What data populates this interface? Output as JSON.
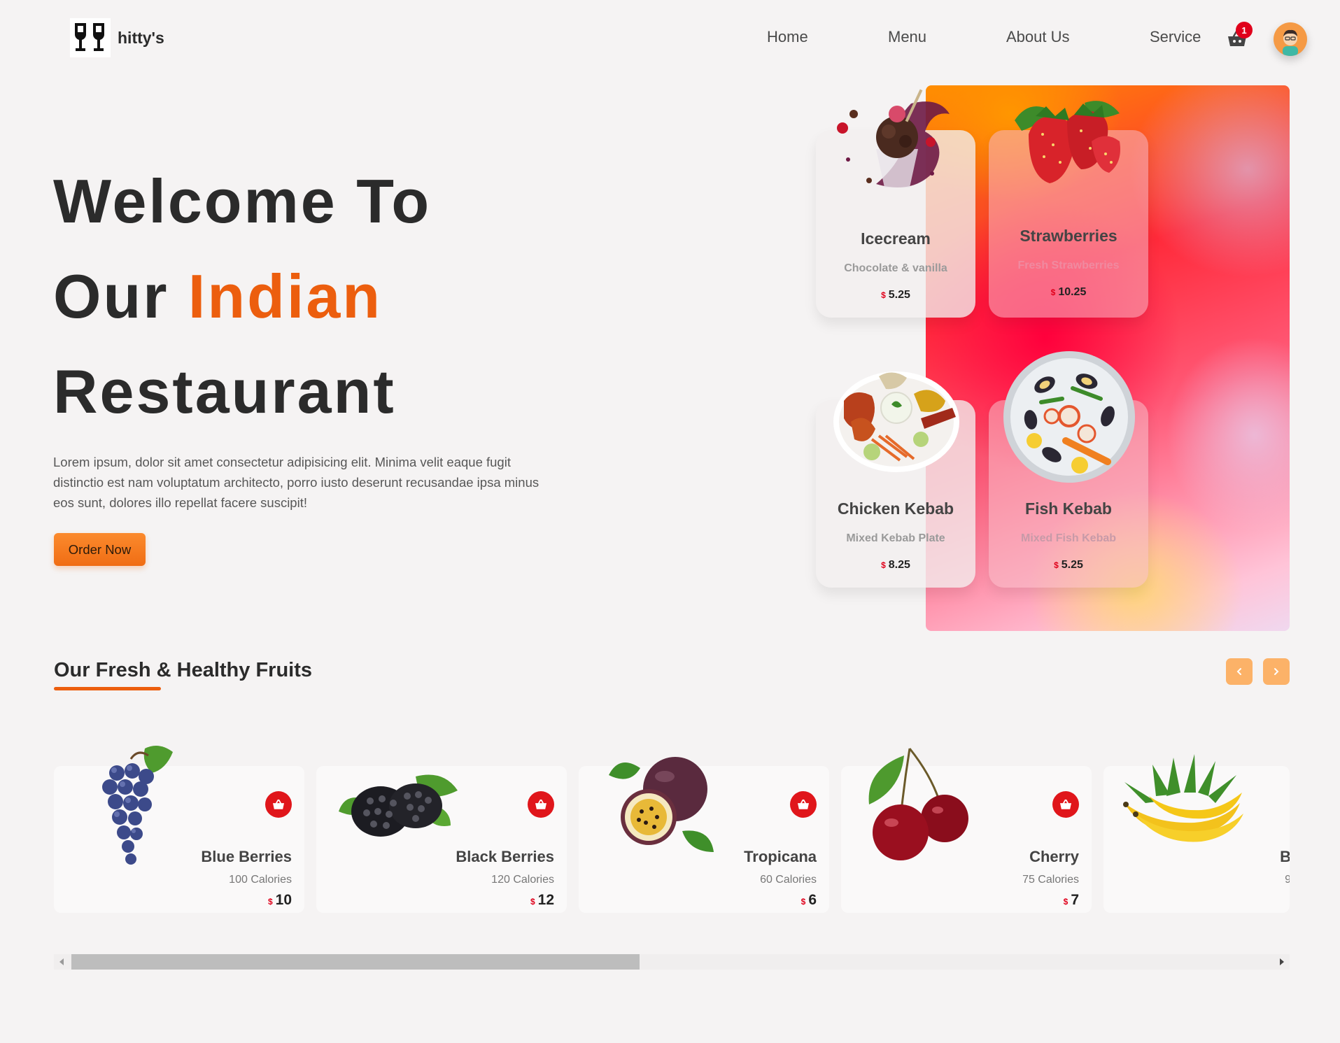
{
  "brand": {
    "name": "hitty's",
    "logo_icon": "wine-glasses-icon"
  },
  "nav": {
    "items": [
      "Home",
      "Menu",
      "About Us",
      "Service"
    ],
    "cart_icon": "basket-icon",
    "cart_count": "1",
    "avatar_icon": "user-avatar-icon"
  },
  "hero": {
    "line1": "Welcome To",
    "line2_plain": "Our",
    "line2_accent": "Indian",
    "line3": "Restaurant",
    "description": "Lorem ipsum, dolor sit amet consectetur adipisicing elit. Minima velit eaque fugit distinctio est nam voluptatum architecto, porro iusto deserunt recusandae ipsa minus eos sunt, dolores illo repellat facere suscipit!",
    "cta": "Order Now",
    "accent_color": "#ec5e0e"
  },
  "featured": [
    {
      "name": "Icecream",
      "sub": "Chocolate & vanilla",
      "currency": "$",
      "price": "5.25",
      "image": "icecream-sundae"
    },
    {
      "name": "Strawberries",
      "sub": "Fresh Strawberries",
      "currency": "$",
      "price": "10.25",
      "image": "strawberries"
    },
    {
      "name": "Chicken Kebab",
      "sub": "Mixed Kebab Plate",
      "currency": "$",
      "price": "8.25",
      "image": "kebab-plate"
    },
    {
      "name": "Fish Kebab",
      "sub": "Mixed Fish Kebab",
      "currency": "$",
      "price": "5.25",
      "image": "seafood-plate"
    }
  ],
  "fruits_section": {
    "title": "Our Fresh & Healthy Fruits",
    "prev_icon": "chevron-left-icon",
    "next_icon": "chevron-right-icon",
    "items": [
      {
        "name": "Blue Berries",
        "calories": "100 Calories",
        "currency": "$",
        "price": "10",
        "image": "grapes"
      },
      {
        "name": "Black Berries",
        "calories": "120 Calories",
        "currency": "$",
        "price": "12",
        "image": "blackberries"
      },
      {
        "name": "Tropicana",
        "calories": "60 Calories",
        "currency": "$",
        "price": "6",
        "image": "passion-fruit"
      },
      {
        "name": "Cherry",
        "calories": "75 Calories",
        "currency": "$",
        "price": "7",
        "image": "cherries"
      },
      {
        "name": "B",
        "calories": "9",
        "currency": "",
        "price": "",
        "image": "bananas"
      }
    ]
  }
}
